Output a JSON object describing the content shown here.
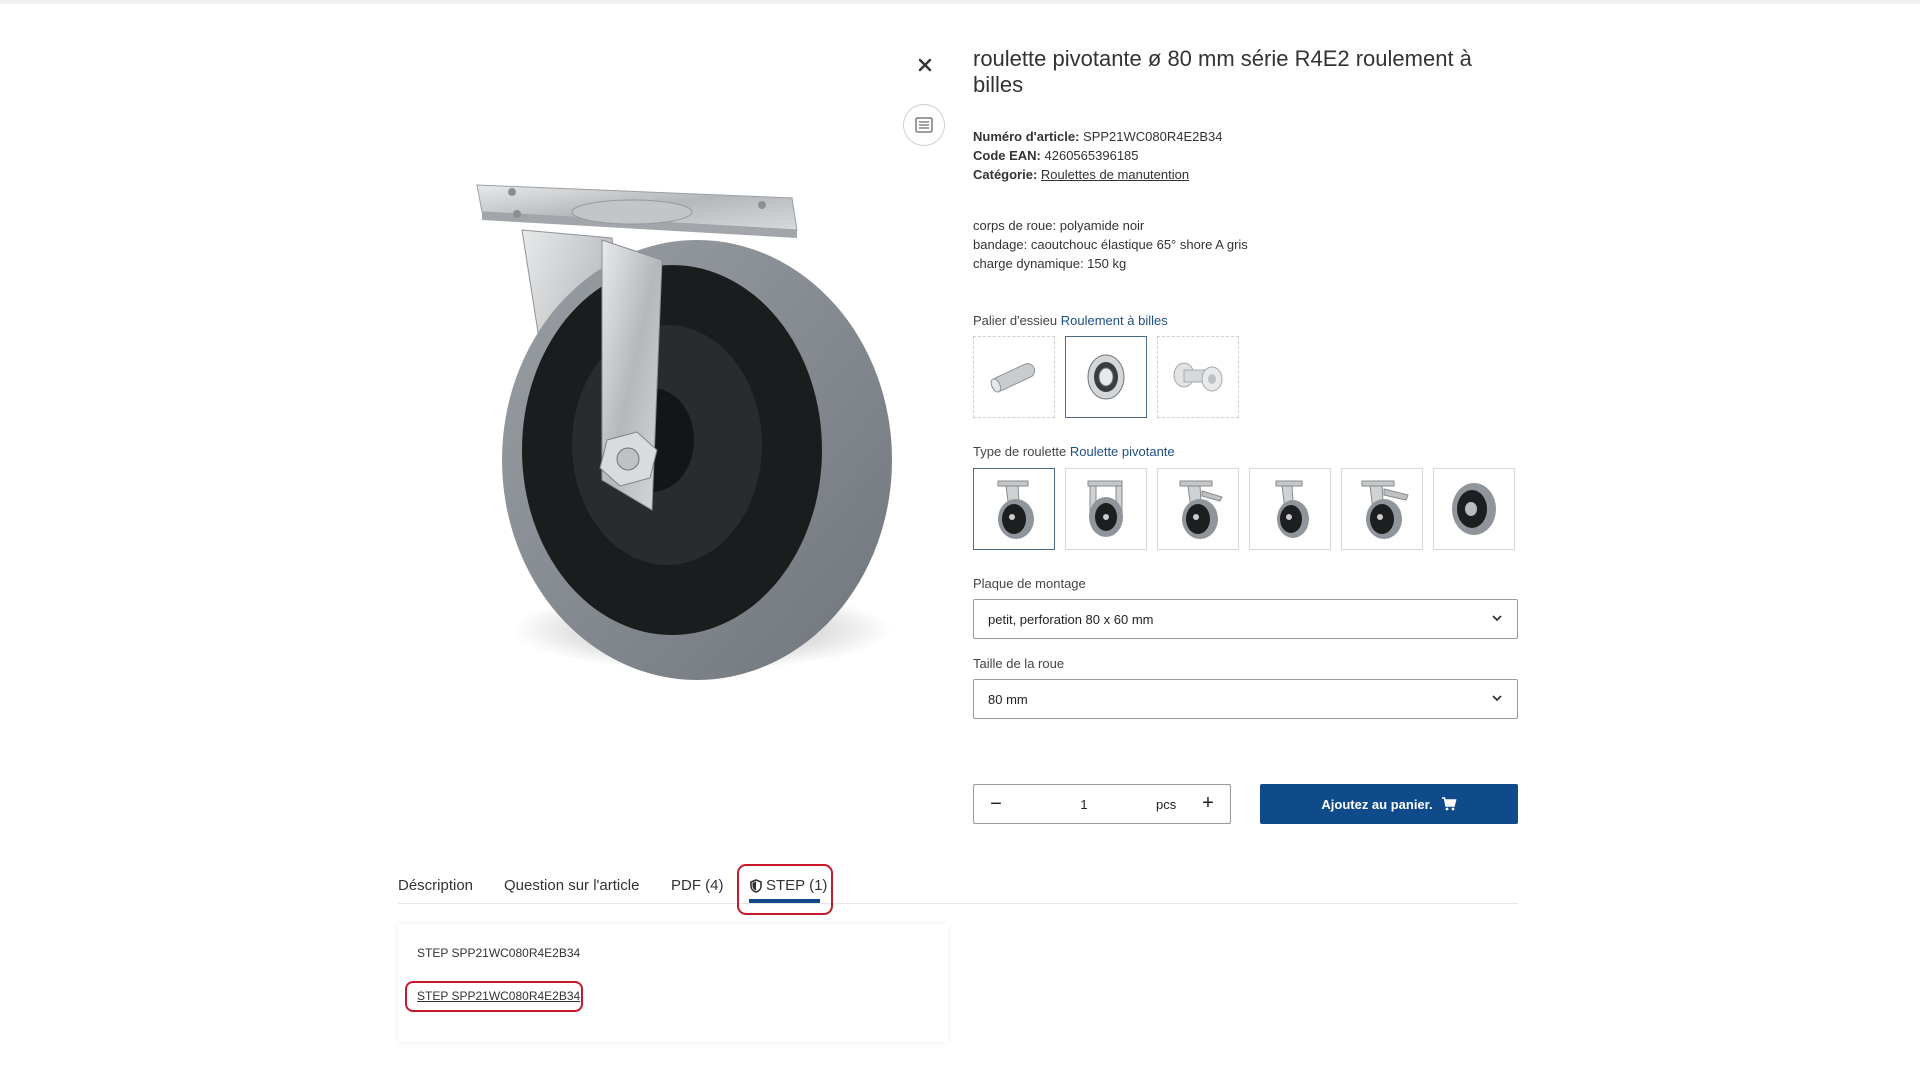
{
  "product": {
    "title": "roulette pivotante ø 80 mm série R4E2 roulement à billes",
    "article_label": "Numéro d'article:",
    "article_value": "SPP21WC080R4E2B34",
    "ean_label": "Code EAN:",
    "ean_value": "4260565396185",
    "category_label": "Catégorie:",
    "category_value": "Roulettes de manutention",
    "description": [
      "corps de roue: polyamide noir",
      "bandage: caoutchouc élastique 65° shore A gris",
      "charge dynamique: 150 kg"
    ]
  },
  "options": {
    "bearing": {
      "label": "Palier d'essieu",
      "value": "Roulement à billes",
      "tiles": [
        "roller-bearing",
        "ball-bearing",
        "plain-bearing"
      ],
      "selected_index": 1
    },
    "caster_type": {
      "label": "Type de roulette",
      "value": "Roulette pivotante",
      "tiles": [
        "swivel-caster",
        "fixed-caster",
        "swivel-brake-caster",
        "swivel-caster-variant",
        "swivel-total-lock-caster",
        "wheel-only"
      ],
      "selected_index": 0
    },
    "mounting_plate": {
      "label": "Plaque de montage",
      "value": "petit, perforation 80 x 60 mm"
    },
    "wheel_size": {
      "label": "Taille de la roue",
      "value": "80 mm"
    }
  },
  "purchase": {
    "quantity": "1",
    "unit": "pcs",
    "add_to_cart_label": "Ajoutez au panier."
  },
  "tabs": [
    {
      "label": "Déscription"
    },
    {
      "label": "Question sur l'article"
    },
    {
      "label": "PDF (4)"
    },
    {
      "label": "STEP (1)",
      "active": true
    }
  ],
  "step_panel": {
    "file_title": "STEP SPP21WC080R4E2B34",
    "file_link": "STEP SPP21WC080R4E2B34"
  },
  "icons": {
    "close": "close-icon",
    "spec": "list-icon",
    "cart": "cart-icon",
    "shield": "shield-icon",
    "chevron": "chevron-down-icon"
  },
  "colors": {
    "primary": "#0f4b8a",
    "link": "#1f4e82",
    "annotation": "#c8192a"
  }
}
